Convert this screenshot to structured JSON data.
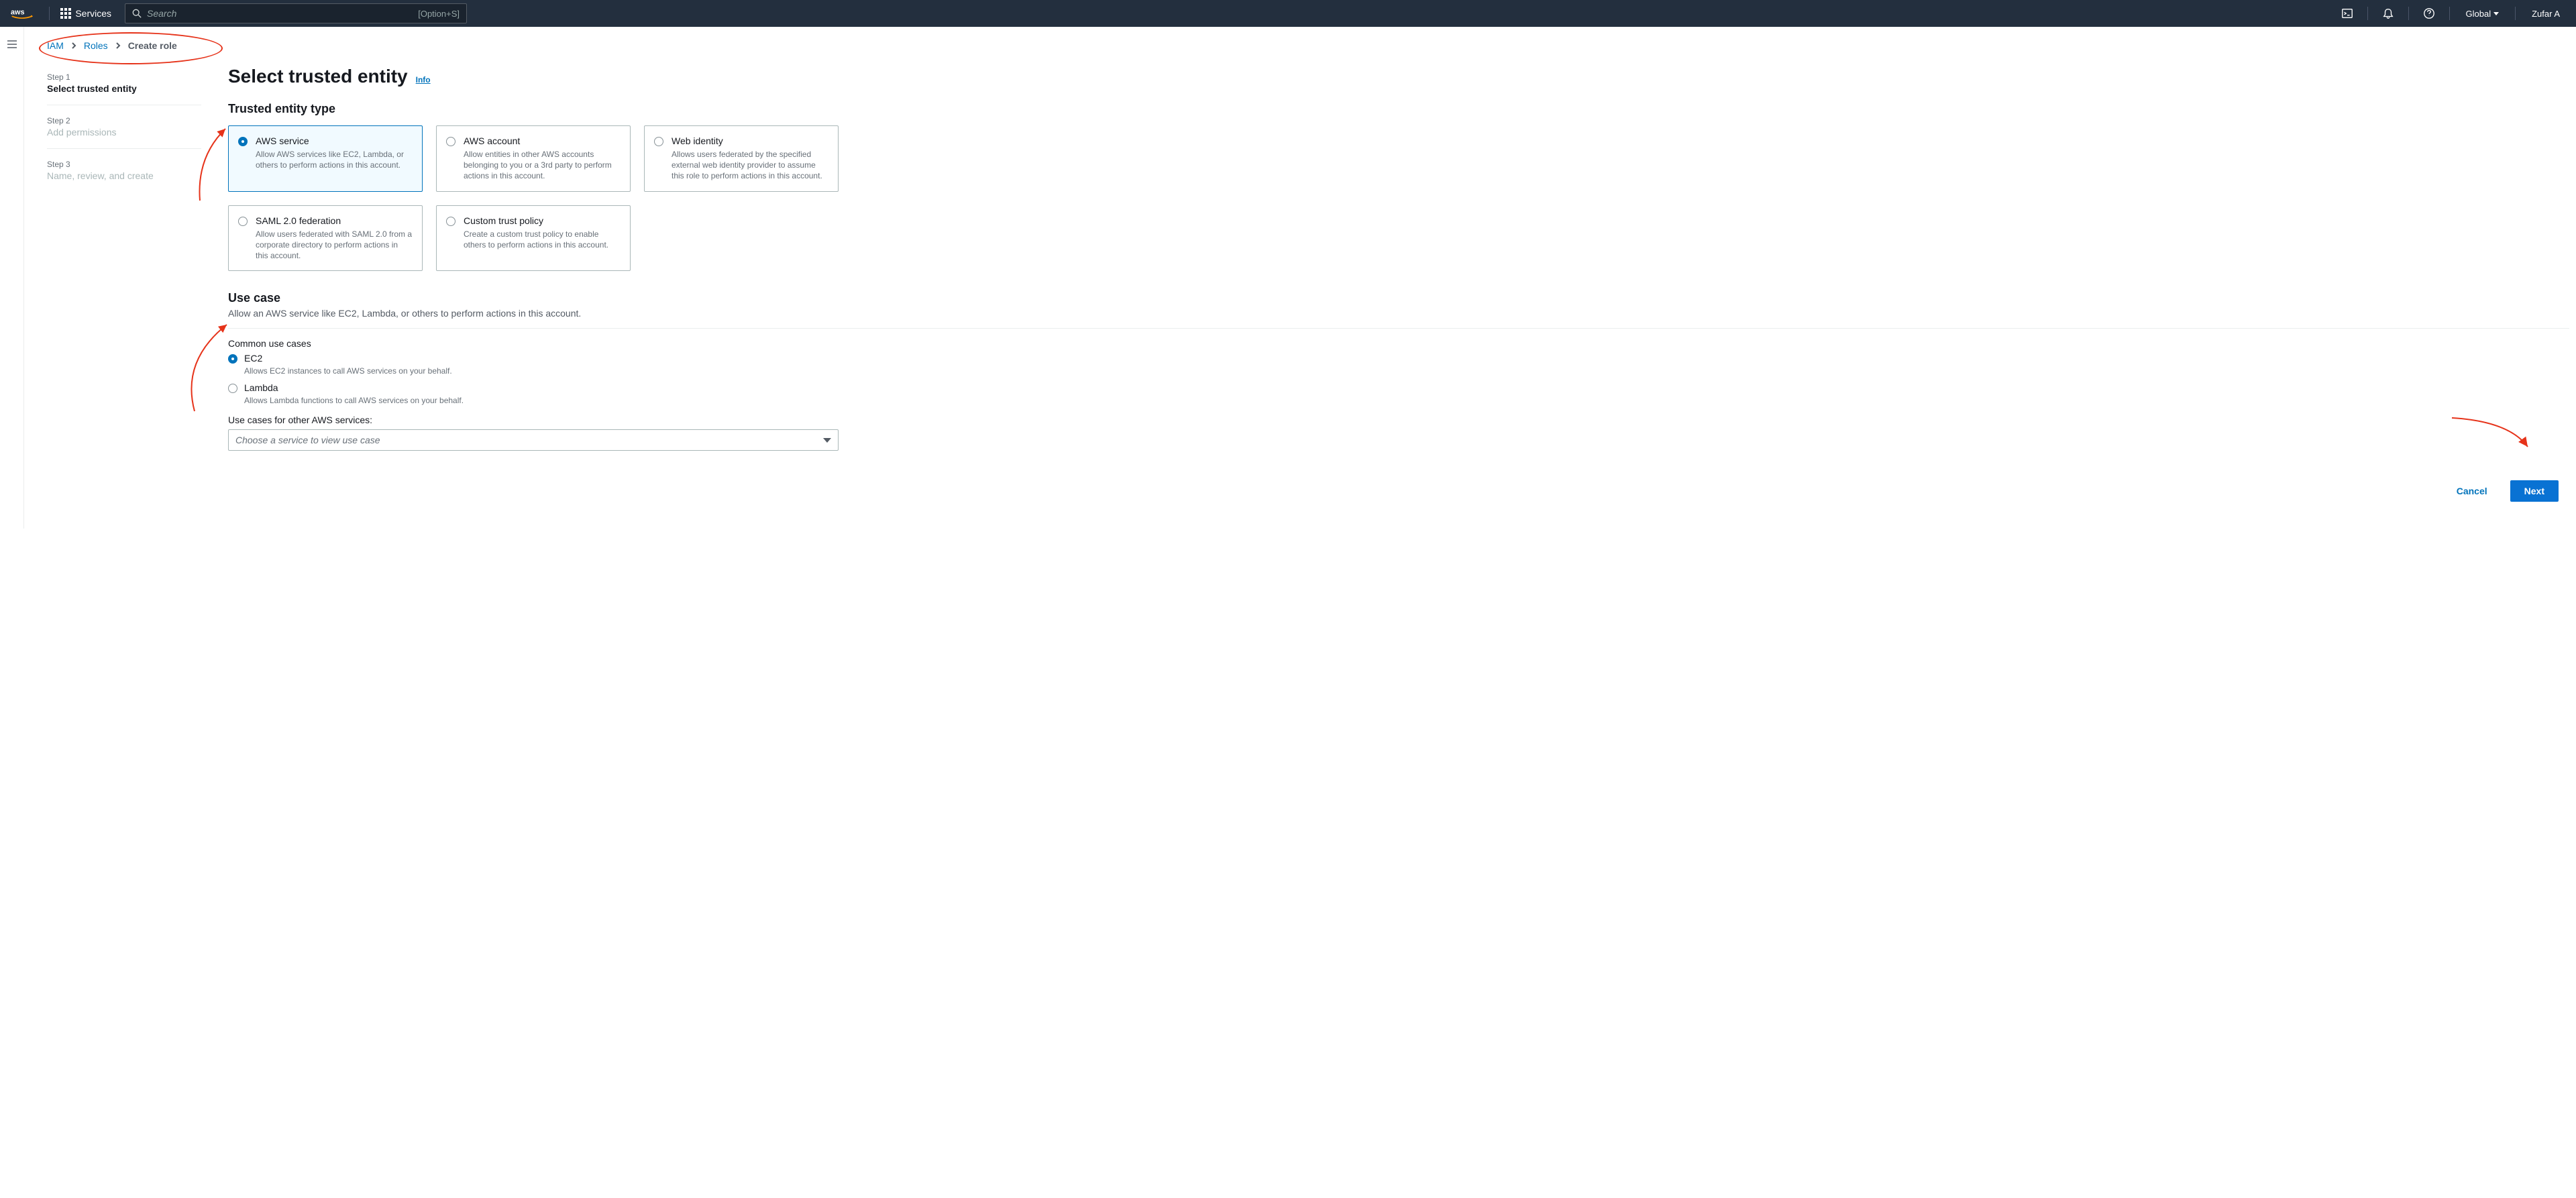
{
  "nav": {
    "services_label": "Services",
    "search_placeholder": "Search",
    "search_hint": "[Option+S]",
    "region": "Global",
    "user": "Zufar A"
  },
  "breadcrumb": {
    "iam": "IAM",
    "roles": "Roles",
    "create_role": "Create role"
  },
  "stepper": [
    {
      "num": "Step 1",
      "title": "Select trusted entity",
      "active": true
    },
    {
      "num": "Step 2",
      "title": "Add permissions",
      "active": false
    },
    {
      "num": "Step 3",
      "title": "Name, review, and create",
      "active": false
    }
  ],
  "page": {
    "title": "Select trusted entity",
    "info": "Info",
    "entity_heading": "Trusted entity type",
    "tiles": [
      {
        "title": "AWS service",
        "desc": "Allow AWS services like EC2, Lambda, or others to perform actions in this account.",
        "selected": true
      },
      {
        "title": "AWS account",
        "desc": "Allow entities in other AWS accounts belonging to you or a 3rd party to perform actions in this account.",
        "selected": false
      },
      {
        "title": "Web identity",
        "desc": "Allows users federated by the specified external web identity provider to assume this role to perform actions in this account.",
        "selected": false
      },
      {
        "title": "SAML 2.0 federation",
        "desc": "Allow users federated with SAML 2.0 from a corporate directory to perform actions in this account.",
        "selected": false
      },
      {
        "title": "Custom trust policy",
        "desc": "Create a custom trust policy to enable others to perform actions in this account.",
        "selected": false
      }
    ],
    "usecase_heading": "Use case",
    "usecase_sub": "Allow an AWS service like EC2, Lambda, or others to perform actions in this account.",
    "common_heading": "Common use cases",
    "common": [
      {
        "label": "EC2",
        "desc": "Allows EC2 instances to call AWS services on your behalf.",
        "selected": true
      },
      {
        "label": "Lambda",
        "desc": "Allows Lambda functions to call AWS services on your behalf.",
        "selected": false
      }
    ],
    "other_heading": "Use cases for other AWS services:",
    "select_placeholder": "Choose a service to view use case",
    "cancel": "Cancel",
    "next": "Next"
  }
}
